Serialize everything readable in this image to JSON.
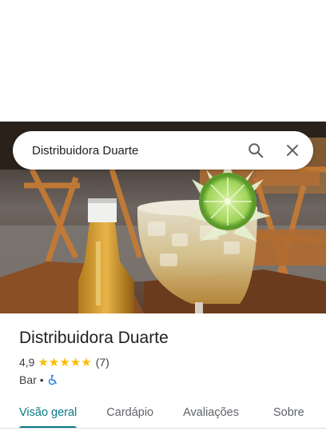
{
  "search": {
    "query": "Distribuidora Duarte",
    "search_icon": "search-icon",
    "close_icon": "close-icon"
  },
  "place": {
    "name": "Distribuidora Duarte",
    "rating": "4,9",
    "stars": 5,
    "review_count": "(7)",
    "category": "Bar",
    "separator": "•",
    "accessibility_icon": "wheelchair-icon"
  },
  "tabs": [
    {
      "label": "Visão geral",
      "active": true
    },
    {
      "label": "Cardápio",
      "active": false
    },
    {
      "label": "Avaliações",
      "active": false
    },
    {
      "label": "Sobre",
      "active": false
    }
  ],
  "colors": {
    "accent": "#0a7a86",
    "star": "#fbbc04",
    "text": "#202124",
    "secondary_text": "#5f6368",
    "accessibility_icon": "#1a73e8"
  }
}
